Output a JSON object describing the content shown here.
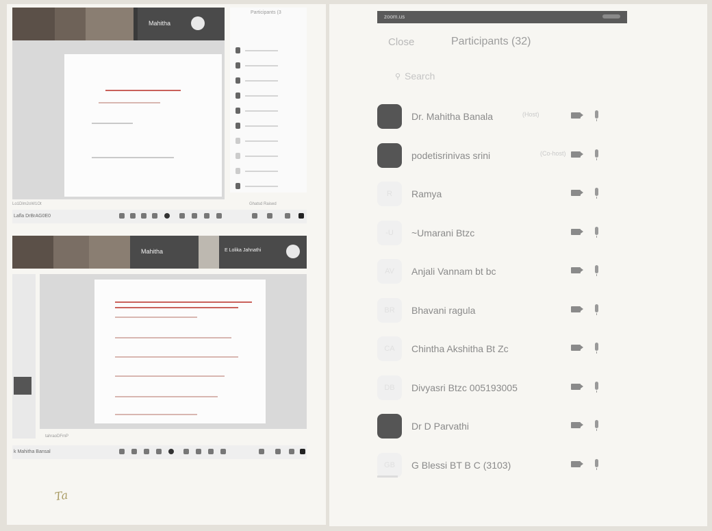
{
  "left_panel": {
    "top_shot": {
      "speaker_name": "Mahitha",
      "participants_title": "Participants (3",
      "toolbar_label": "Lafla DrBrAG0E0",
      "status_left": "Lo1Dlm2oW1Ot",
      "status_right": "Ghatsd  Raised"
    },
    "bottom_shot": {
      "speaker_name": "Mahitha",
      "second_speaker_name": "E Lolika Jahnathi",
      "toolbar_label": "k Mahitha Bansal",
      "status_left": "tahraoDFmP"
    },
    "scribble": "Ta"
  },
  "participants_panel": {
    "topbar_text": "zoom.us",
    "close_label": "Close",
    "title": "Participants (32)",
    "search_icon": "search-icon",
    "search_placeholder": "Search",
    "participants": [
      {
        "name": "Dr. Mahitha Banala",
        "tag": "(Host)",
        "avatar_text": "",
        "avatar_style": "photo"
      },
      {
        "name": "podetisrinivas srini",
        "tag": "(Co-host)",
        "avatar_text": "",
        "avatar_style": "photo"
      },
      {
        "name": "Ramya",
        "tag": "",
        "avatar_text": "R",
        "avatar_style": "pale"
      },
      {
        "name": "~Umarani Btzc",
        "tag": "",
        "avatar_text": "-U",
        "avatar_style": "pale"
      },
      {
        "name": "Anjali Vannam bt bc",
        "tag": "",
        "avatar_text": "AV",
        "avatar_style": "pale"
      },
      {
        "name": "Bhavani ragula",
        "tag": "",
        "avatar_text": "BR",
        "avatar_style": "pale"
      },
      {
        "name": "Chintha Akshitha Bt Zc",
        "tag": "",
        "avatar_text": "CA",
        "avatar_style": "pale"
      },
      {
        "name": "Divyasri Btzc 005193005",
        "tag": "",
        "avatar_text": "DB",
        "avatar_style": "pale"
      },
      {
        "name": "Dr D Parvathi",
        "tag": "",
        "avatar_text": "",
        "avatar_style": "photo"
      },
      {
        "name": "G Blessi BT B C (3103)",
        "tag": "",
        "avatar_text": "GB",
        "avatar_style": "pale"
      }
    ],
    "video_icon": "video-camera-icon",
    "mic_icon": "microphone-icon"
  },
  "colors": {
    "dark_strip": "#3a3a3a",
    "slide_title_red": "#c9605a",
    "paper": "#f7f6f2"
  }
}
